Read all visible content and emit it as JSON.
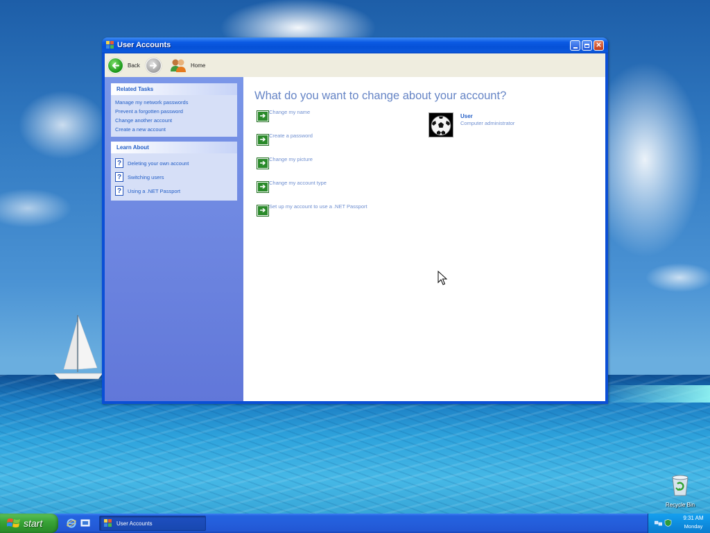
{
  "window": {
    "title": "User Accounts",
    "buttons": {
      "minimize": "minimize",
      "maximize": "maximize",
      "close": "close"
    }
  },
  "toolbar": {
    "back_label": "Back",
    "home_label": "Home"
  },
  "related_tasks": {
    "header": "Related Tasks",
    "items": [
      "Manage my network passwords",
      "Prevent a forgotten password",
      "Change another account",
      "Create a new account"
    ]
  },
  "learn_about": {
    "header": "Learn About",
    "items": [
      "Deleting your own account",
      "Switching users",
      "Using a .NET Passport"
    ]
  },
  "main": {
    "heading": "What do you want to change about your account?",
    "actions": [
      "Change my name",
      "Create a password",
      "Change my picture",
      "Change my account type",
      "Set up my account to use a .NET Passport"
    ]
  },
  "user": {
    "name": "User",
    "role": "Computer administrator",
    "avatar_icon": "soccer-ball-icon"
  },
  "desktop": {
    "recycle_bin_label": "Recycle Bin"
  },
  "taskbar": {
    "start_label": "start",
    "task_button_label": "User Accounts",
    "clock_time": "9:31 AM",
    "clock_day": "Monday"
  },
  "colors": {
    "link_blue": "#215dc6",
    "link_light": "#6f8fd0",
    "heading": "#6584c5",
    "taskpane": "#6177d9",
    "titlebar": "#0651d7",
    "taskbar": "#245edb",
    "start_green": "#3aa538"
  }
}
